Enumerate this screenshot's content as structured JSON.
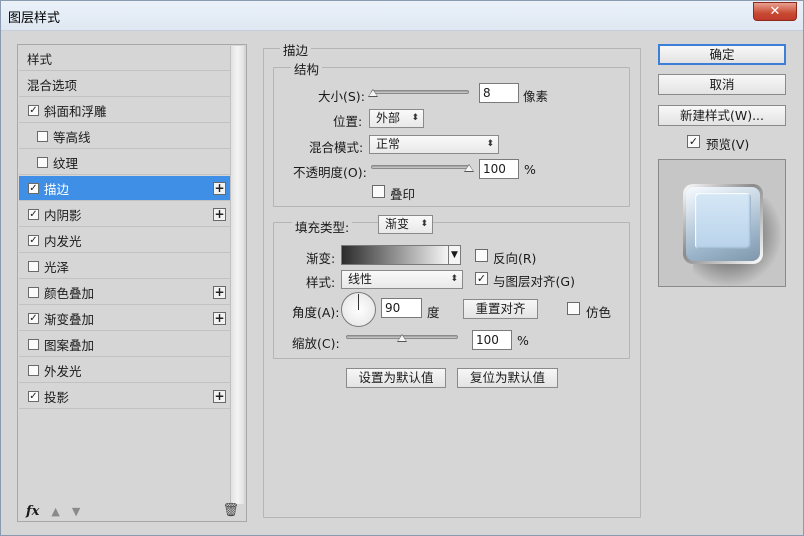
{
  "window": {
    "title": "图层样式",
    "close_glyph": "✕"
  },
  "style_list": {
    "items": [
      {
        "label": "样式",
        "checkbox": false,
        "checked": false,
        "plus": false,
        "indent": false,
        "selected": false
      },
      {
        "label": "混合选项",
        "checkbox": false,
        "checked": false,
        "plus": false,
        "indent": false,
        "selected": false
      },
      {
        "label": "斜面和浮雕",
        "checkbox": true,
        "checked": true,
        "plus": false,
        "indent": false,
        "selected": false
      },
      {
        "label": "等高线",
        "checkbox": true,
        "checked": false,
        "plus": false,
        "indent": true,
        "selected": false
      },
      {
        "label": "纹理",
        "checkbox": true,
        "checked": false,
        "plus": false,
        "indent": true,
        "selected": false
      },
      {
        "label": "描边",
        "checkbox": true,
        "checked": true,
        "plus": true,
        "indent": false,
        "selected": true
      },
      {
        "label": "内阴影",
        "checkbox": true,
        "checked": true,
        "plus": true,
        "indent": false,
        "selected": false
      },
      {
        "label": "内发光",
        "checkbox": true,
        "checked": true,
        "plus": false,
        "indent": false,
        "selected": false
      },
      {
        "label": "光泽",
        "checkbox": true,
        "checked": false,
        "plus": false,
        "indent": false,
        "selected": false
      },
      {
        "label": "颜色叠加",
        "checkbox": true,
        "checked": false,
        "plus": true,
        "indent": false,
        "selected": false
      },
      {
        "label": "渐变叠加",
        "checkbox": true,
        "checked": true,
        "plus": true,
        "indent": false,
        "selected": false
      },
      {
        "label": "图案叠加",
        "checkbox": true,
        "checked": false,
        "plus": false,
        "indent": false,
        "selected": false
      },
      {
        "label": "外发光",
        "checkbox": true,
        "checked": false,
        "plus": false,
        "indent": false,
        "selected": false
      },
      {
        "label": "投影",
        "checkbox": true,
        "checked": true,
        "plus": true,
        "indent": false,
        "selected": false
      }
    ],
    "footer": {
      "fx_label": "fx",
      "up_glyph": "▲",
      "down_glyph": "▼",
      "trash_glyph": "🗑"
    }
  },
  "stroke": {
    "section_title": "描边",
    "structure_title": "结构",
    "size_label": "大小(S):",
    "size_value": "8",
    "size_unit": "像素",
    "size_slider_fraction": 0.02,
    "position_label": "位置:",
    "position_value": "外部",
    "blend_label": "混合模式:",
    "blend_value": "正常",
    "opacity_label": "不透明度(O):",
    "opacity_value": "100",
    "opacity_unit": "%",
    "opacity_slider_fraction": 1.0,
    "overprint_label": "叠印",
    "overprint_checked": false,
    "fill_type_label": "填充类型:",
    "fill_type_value": "渐变",
    "gradient_label": "渐变:",
    "reverse_label": "反向(R)",
    "reverse_checked": false,
    "style_label": "样式:",
    "style_value": "线性",
    "align_label": "与图层对齐(G)",
    "align_checked": true,
    "angle_label": "角度(A):",
    "angle_value": "90",
    "angle_unit": "度",
    "reset_align_label": "重置对齐",
    "dither_label": "仿色",
    "dither_checked": false,
    "scale_label": "缩放(C):",
    "scale_value": "100",
    "scale_unit": "%",
    "scale_slider_fraction": 0.5,
    "set_default_label": "设置为默认值",
    "reset_default_label": "复位为默认值"
  },
  "actions": {
    "ok_label": "确定",
    "cancel_label": "取消",
    "new_style_label": "新建样式(W)...",
    "preview_label": "预览(V)",
    "preview_checked": true
  },
  "glyphs": {
    "check": "✓",
    "plus": "+",
    "caret": "⬍",
    "caret_down": "▼"
  },
  "colors": {
    "selection": "#3f8fe6",
    "default_button_border": "#3b7fd9"
  }
}
